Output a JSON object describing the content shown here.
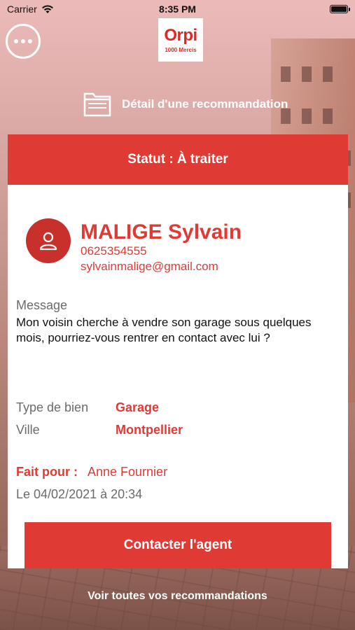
{
  "status_bar": {
    "carrier": "Carrier",
    "time": "8:35 PM"
  },
  "logo": {
    "brand": "Orpi",
    "sub": "1000 Mercis"
  },
  "page_subtitle": "Détail d'une recommandation",
  "card": {
    "status": "Statut : À traiter",
    "contact": {
      "name": "MALIGE Sylvain",
      "phone": "0625354555",
      "email": "sylvainmalige@gmail.com"
    },
    "message_label": "Message",
    "message_text": "Mon voisin cherche à vendre son garage sous quelques mois, pourriez-vous rentrer en contact avec lui ?",
    "property_type_label": "Type de bien",
    "property_type_value": "Garage",
    "city_label": "Ville",
    "city_value": "Montpellier",
    "made_for_label": "Fait pour :",
    "made_for_value": "Anne Fournier",
    "date": "Le 04/02/2021 à 20:34",
    "cta_label": "Contacter l'agent"
  },
  "footer_link": "Voir toutes vos recommandations",
  "colors": {
    "accent": "#e03a35",
    "avatar": "#c8302b"
  }
}
